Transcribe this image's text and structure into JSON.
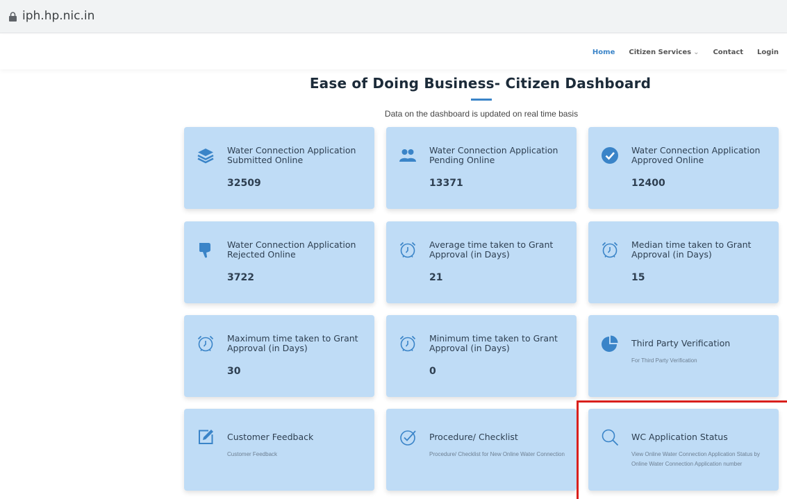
{
  "browser": {
    "url": "iph.hp.nic.in"
  },
  "nav": {
    "items": [
      {
        "label": "Home",
        "active": true
      },
      {
        "label": "Citizen Services",
        "dropdown": true
      },
      {
        "label": "Contact"
      },
      {
        "label": "Login"
      }
    ],
    "caret": "⌄"
  },
  "page": {
    "title": "Ease of Doing Business- Citizen Dashboard",
    "subtitle": "Data on the dashboard is updated on real time basis"
  },
  "cards": [
    {
      "icon": "layers-icon",
      "title": "Water Connection Application Submitted Online",
      "value": "32509"
    },
    {
      "icon": "users-icon",
      "title": "Water Connection Application Pending Online",
      "value": "13371"
    },
    {
      "icon": "check-circle-icon",
      "title": "Water Connection Application Approved Online",
      "value": "12400"
    },
    {
      "icon": "thumbs-down-icon",
      "title": "Water Connection Application Rejected Online",
      "value": "3722"
    },
    {
      "icon": "alarm-clock-icon",
      "title": "Average time taken to Grant Approval (in Days)",
      "value": "21"
    },
    {
      "icon": "alarm-clock-icon",
      "title": "Median time taken to Grant Approval (in Days)",
      "value": "15"
    },
    {
      "icon": "alarm-clock-icon",
      "title": "Maximum time taken to Grant Approval (in Days)",
      "value": "30"
    },
    {
      "icon": "alarm-clock-icon",
      "title": "Minimum time taken to Grant Approval (in Days)",
      "value": "0"
    },
    {
      "icon": "pie-chart-icon",
      "title": "Third Party Verification",
      "desc": "For Third Party Verification"
    },
    {
      "icon": "edit-icon",
      "title": "Customer Feedback",
      "desc": "Customer Feedback"
    },
    {
      "icon": "check-badge-icon",
      "title": "Procedure/ Checklist",
      "desc": "Procedure/ Checklist for New Online Water Connection"
    },
    {
      "icon": "search-icon",
      "title": "WC Application Status",
      "desc": "View Online Water Connection Application Status by Online Water Connection Application number"
    }
  ],
  "colors": {
    "card_bg": "#bfdcf6",
    "accent": "#3a84c8",
    "highlight": "#d9201c"
  }
}
